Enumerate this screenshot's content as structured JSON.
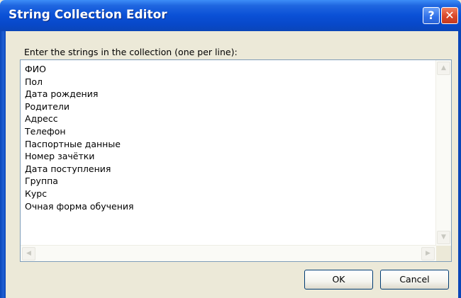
{
  "window": {
    "title": "String Collection Editor",
    "help_glyph": "?",
    "close_glyph": "✕"
  },
  "prompt": "Enter the strings in the collection (one per line):",
  "editor": {
    "lines": [
      "ФИО",
      "Пол",
      "Дата рождения",
      "Родители",
      "Адресс",
      "Телефон",
      "Паспортные данные",
      "Номер зачётки",
      "Дата поступления",
      "Группа",
      "Курс",
      "Очная форма обучения"
    ]
  },
  "scrollbar_glyphs": {
    "up": "▲",
    "down": "▼",
    "left": "◀",
    "right": "▶"
  },
  "buttons": {
    "ok": "OK",
    "cancel": "Cancel"
  },
  "colors": {
    "titlebar": "#0a50d6",
    "dialog_background": "#ece9d8",
    "close_button": "#d9482a",
    "button_border": "#003c74"
  }
}
